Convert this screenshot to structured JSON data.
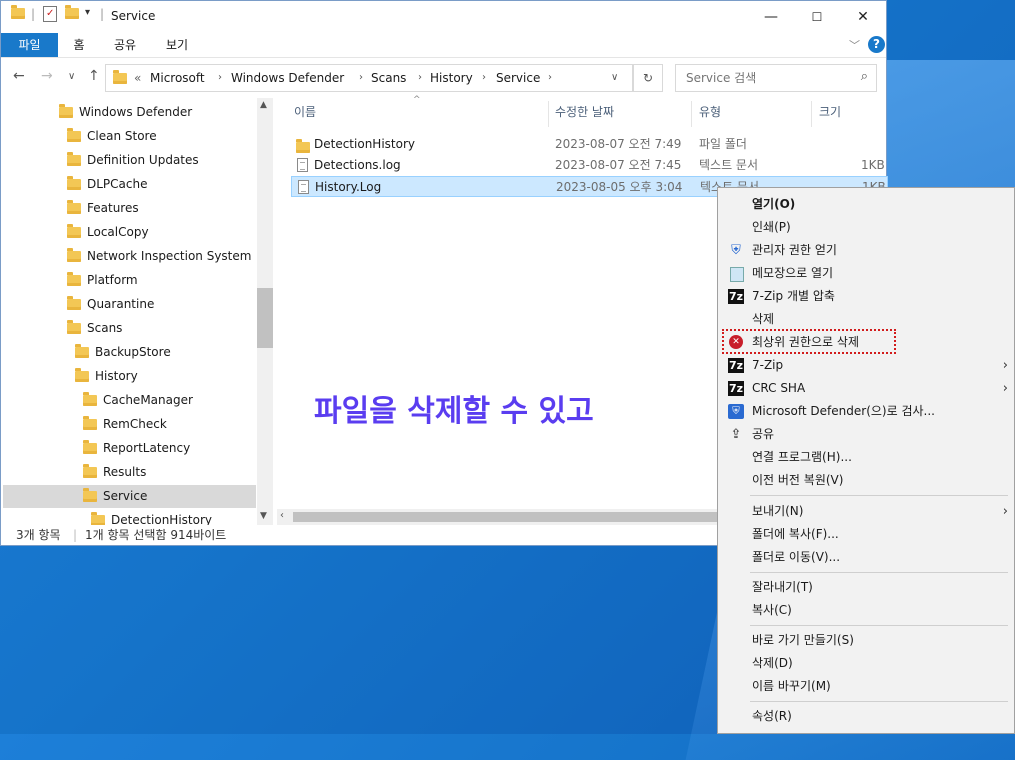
{
  "window": {
    "title": "Service",
    "controls": {
      "minimize": "—",
      "maximize": "☐",
      "close": "✕"
    }
  },
  "ribbon": {
    "tabs": [
      {
        "label": "파일"
      },
      {
        "label": "홈"
      },
      {
        "label": "공유"
      },
      {
        "label": "보기"
      }
    ]
  },
  "address": {
    "overflow": "«",
    "crumbs": [
      "Microsoft",
      "Windows Defender",
      "Scans",
      "History",
      "Service"
    ]
  },
  "search": {
    "placeholder": "Service 검색"
  },
  "tree": {
    "items": [
      {
        "label": "Windows Defender"
      },
      {
        "label": "Clean Store"
      },
      {
        "label": "Definition Updates"
      },
      {
        "label": "DLPCache"
      },
      {
        "label": "Features"
      },
      {
        "label": "LocalCopy"
      },
      {
        "label": "Network Inspection System"
      },
      {
        "label": "Platform"
      },
      {
        "label": "Quarantine"
      },
      {
        "label": "Scans"
      },
      {
        "label": "BackupStore"
      },
      {
        "label": "History"
      },
      {
        "label": "CacheManager"
      },
      {
        "label": "RemCheck"
      },
      {
        "label": "ReportLatency"
      },
      {
        "label": "Results"
      },
      {
        "label": "Service"
      },
      {
        "label": "DetectionHistory"
      }
    ]
  },
  "columns": {
    "name": "이름",
    "date": "수정한 날짜",
    "type": "유형",
    "size": "크기"
  },
  "files": [
    {
      "name": "DetectionHistory",
      "date": "2023-08-07 오전 7:49",
      "type": "파일 폴더",
      "size": ""
    },
    {
      "name": "Detections.log",
      "date": "2023-08-07 오전 7:45",
      "type": "텍스트 문서",
      "size": "1KB"
    },
    {
      "name": "History.Log",
      "date": "2023-08-05 오후 3:04",
      "type": "텍스트 문서",
      "size": "1KB"
    }
  ],
  "status": {
    "count": "3개 항목",
    "selection": "1개 항목 선택함 914바이트"
  },
  "annotation": "파일을 삭제할 수 있고",
  "context_menu": {
    "items": [
      {
        "label": "열기(O)"
      },
      {
        "label": "인쇄(P)"
      },
      {
        "label": "관리자 권한 얻기"
      },
      {
        "label": "메모장으로 열기"
      },
      {
        "label": "7-Zip 개별 압축"
      },
      {
        "label": "삭제"
      },
      {
        "label": "최상위 권한으로 삭제"
      },
      {
        "label": "7-Zip"
      },
      {
        "label": "CRC SHA"
      },
      {
        "label": "Microsoft Defender(으)로 검사..."
      },
      {
        "label": "공유"
      },
      {
        "label": "연결 프로그램(H)..."
      },
      {
        "label": "이전 버전 복원(V)"
      },
      {
        "label": "보내기(N)"
      },
      {
        "label": "폴더에 복사(F)..."
      },
      {
        "label": "폴더로 이동(V)..."
      },
      {
        "label": "잘라내기(T)"
      },
      {
        "label": "복사(C)"
      },
      {
        "label": "바로 가기 만들기(S)"
      },
      {
        "label": "삭제(D)"
      },
      {
        "label": "이름 바꾸기(M)"
      },
      {
        "label": "속성(R)"
      }
    ],
    "icon_labels": {
      "sevenzip": "7z"
    }
  }
}
